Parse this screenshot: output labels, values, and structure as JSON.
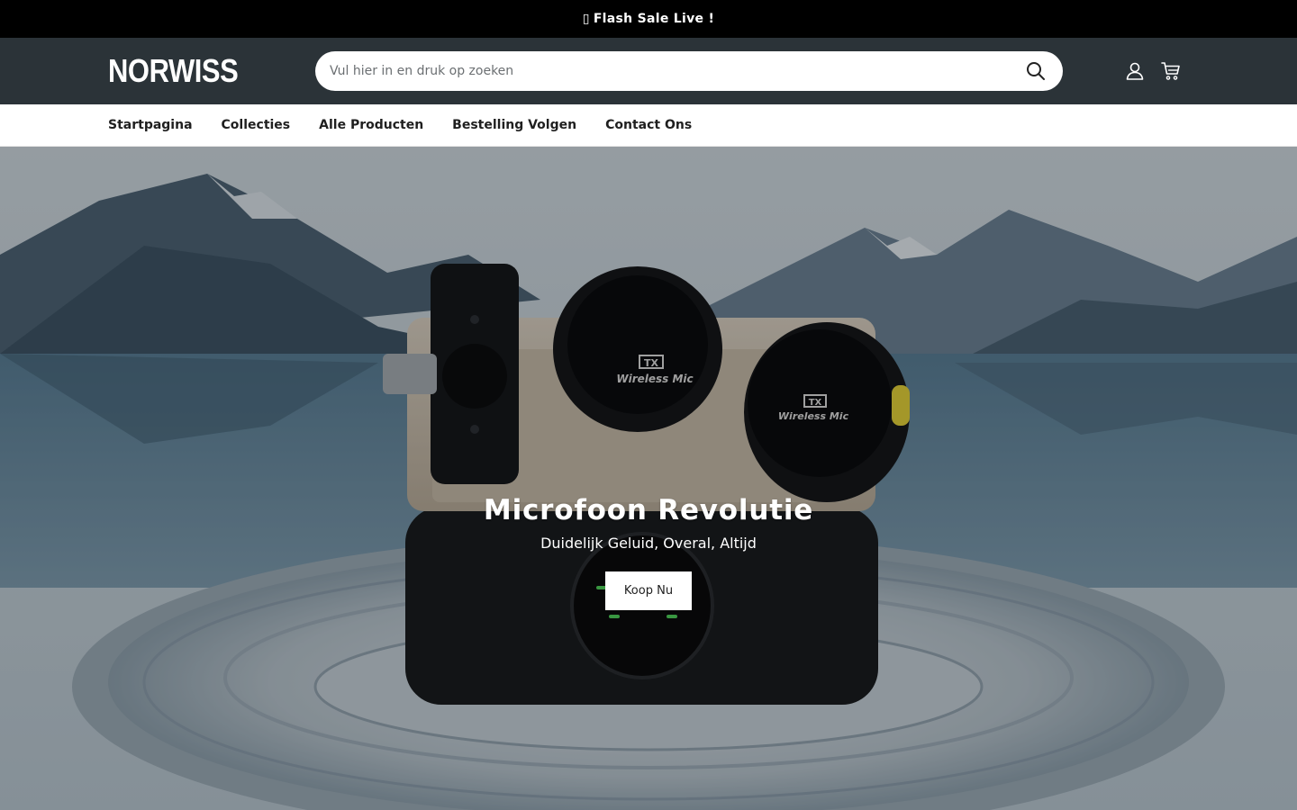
{
  "announcement": {
    "glyph": "▯",
    "text": "Flash Sale Live !"
  },
  "header": {
    "logo": "NORWISS",
    "search": {
      "placeholder": "Vul hier in en druk op zoeken",
      "value": ""
    },
    "icons": [
      "search-icon",
      "account-icon",
      "cart-icon"
    ]
  },
  "nav": {
    "items": [
      "Startpagina",
      "Collecties",
      "Alle Producten",
      "Bestelling Volgen",
      "Contact Ons"
    ]
  },
  "hero": {
    "title": "Microfoon Revolutie",
    "subtitle": "Duidelijk Geluid, Overal, Altijd",
    "button": "Koop Nu",
    "mic_label": "Wireless Mic",
    "mic_badge": "TX"
  },
  "colors": {
    "announcement_bg": "#000000",
    "header_bg": "#2b3338",
    "accent_yellow": "#e3d23a",
    "led_green": "#4fd05a"
  }
}
